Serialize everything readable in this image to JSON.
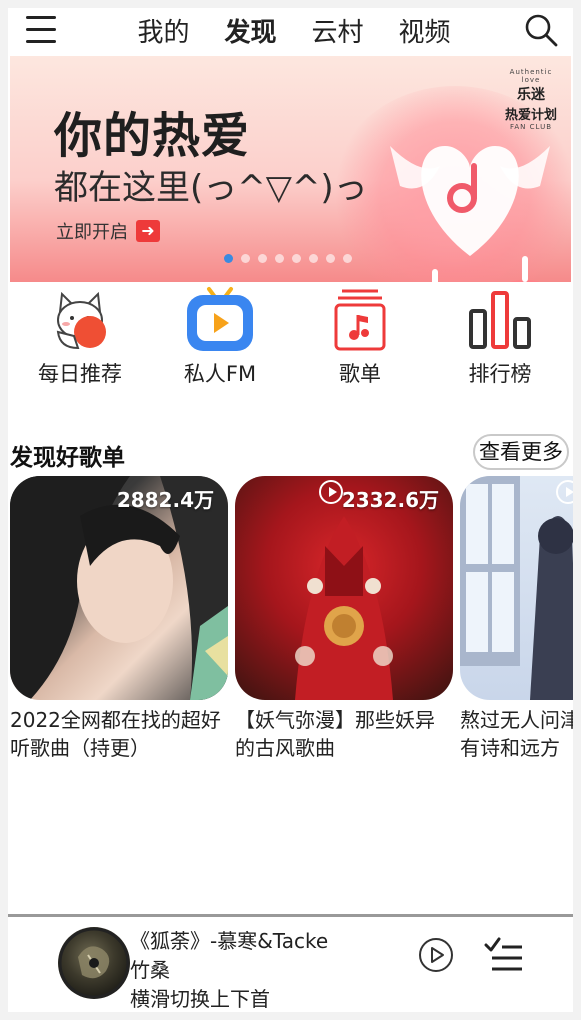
{
  "header": {
    "menu_icon": "hamburger-menu-icon",
    "tabs": [
      {
        "label": "我的",
        "active": false
      },
      {
        "label": "发现",
        "active": true
      },
      {
        "label": "云村",
        "active": false
      },
      {
        "label": "视频",
        "active": false
      }
    ],
    "search_icon": "search-icon"
  },
  "banner": {
    "title": "你的热爱",
    "subtitle": "都在这里(っ^▽^)っ",
    "cta": "立即开启",
    "logo_line1": "乐迷",
    "logo_line2": "热爱计划",
    "logo_line3": "FAN CLUB",
    "logo_script": "Authentic love",
    "page_count": 8,
    "active_page": 1
  },
  "shortcuts": [
    {
      "label": "每日推荐",
      "icon": "lucky-cat-icon"
    },
    {
      "label": "私人FM",
      "icon": "radio-play-icon"
    },
    {
      "label": "歌单",
      "icon": "playlist-music-icon"
    },
    {
      "label": "排行榜",
      "icon": "ranking-bars-icon"
    }
  ],
  "section": {
    "title": "发现好歌单",
    "more": "查看更多"
  },
  "playlists": [
    {
      "count": "2882.4万",
      "title": "2022全网都在找的超好听歌曲（持更）"
    },
    {
      "count": "2332.6万",
      "title": "【妖气弥漫】那些妖异的古风歌曲"
    },
    {
      "count": "",
      "title": "熬过无人问津的日子才有诗和远方"
    }
  ],
  "player": {
    "song": "《狐荼》-慕寒&Tacke竹桑",
    "hint": "横滑切换上下首",
    "play_icon": "play-circle-icon",
    "list_icon": "playlist-queue-icon"
  },
  "colors": {
    "accent_red": "#ee3a3a",
    "fm_blue": "#3a86f0",
    "dot_active": "#3b8ae0"
  }
}
